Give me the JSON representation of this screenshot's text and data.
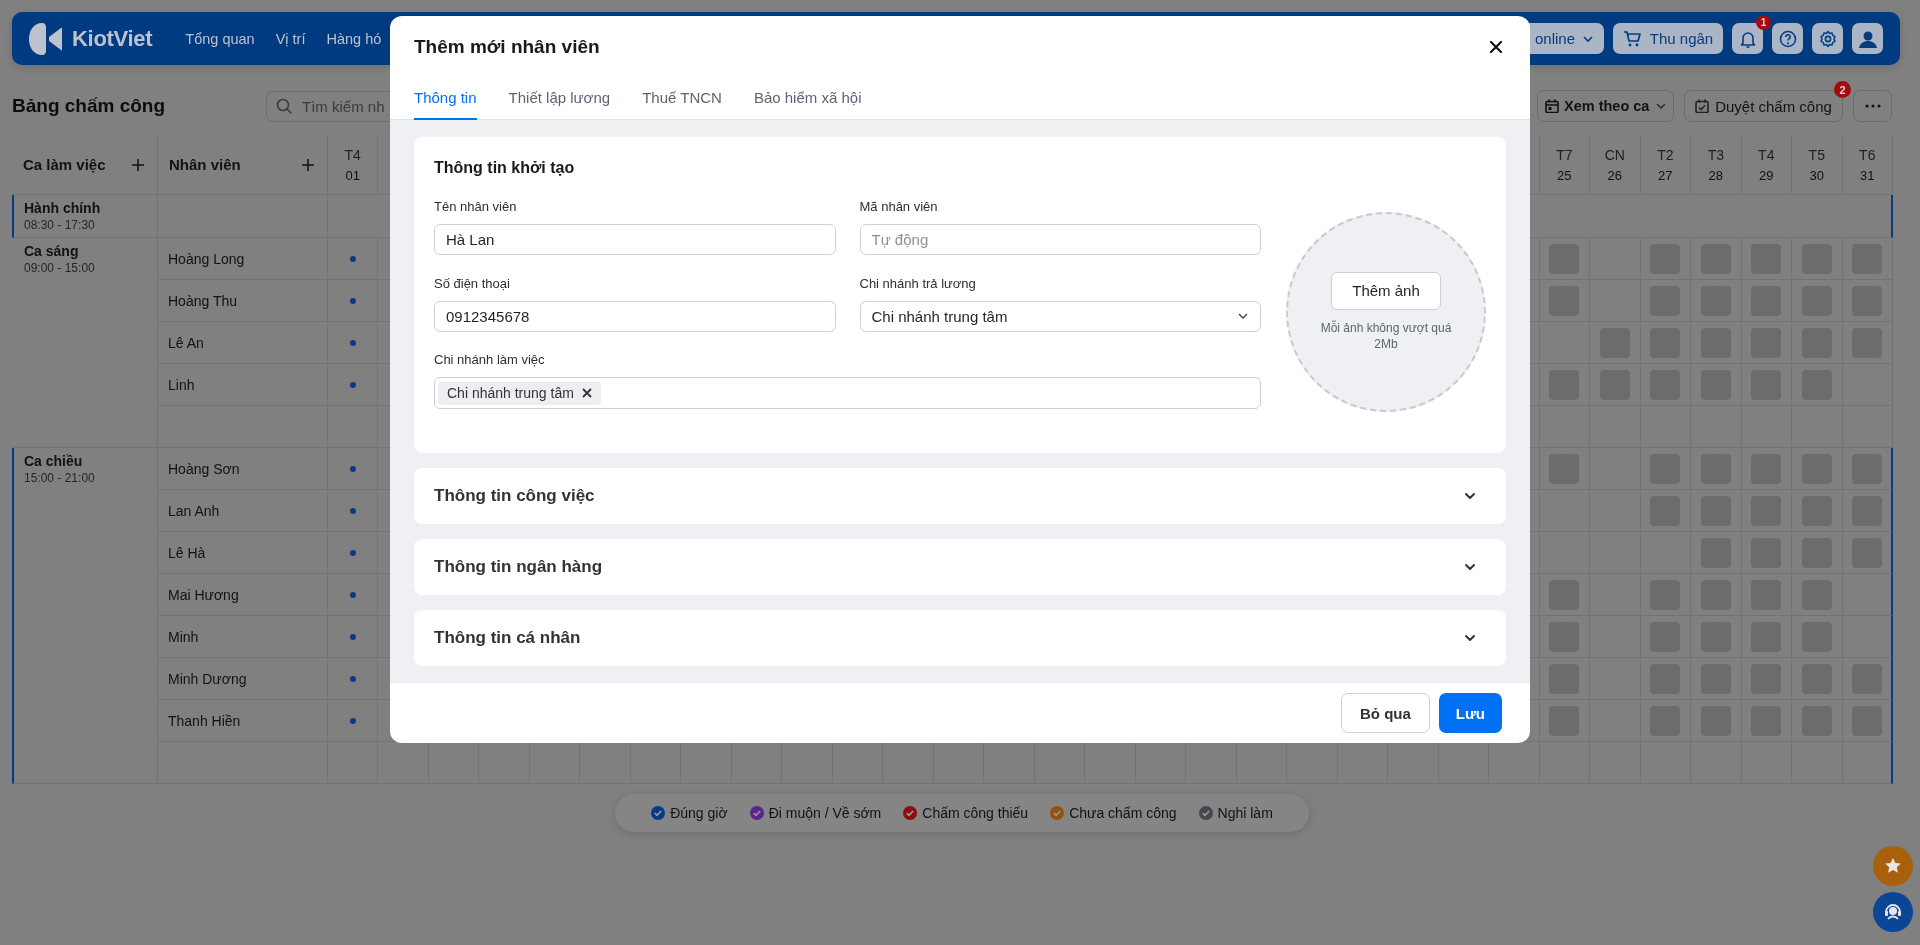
{
  "header": {
    "brand": "KiotViet",
    "nav": [
      {
        "label": "Tổng quan"
      },
      {
        "label": "Vị trí"
      },
      {
        "label": "Hàng hó"
      }
    ],
    "online_button": "online",
    "cashier_button": "Thu ngân",
    "notification_count": "1"
  },
  "toolbar": {
    "title": "Bảng chấm công",
    "search": {
      "placeholder": "Tìm kiếm nh"
    },
    "view_select": "Xem theo ca",
    "approve_button": "Duyệt chấm công",
    "approve_count": "2"
  },
  "table": {
    "columns": {
      "shift": "Ca làm việc",
      "employee": "Nhân viên"
    },
    "days_left": [
      {
        "weekday": "T4",
        "date": "01",
        "kind": "dot"
      }
    ],
    "days_right": [
      {
        "weekday": "T7",
        "date": "25",
        "kind": "block"
      },
      {
        "weekday": "CN",
        "date": "26",
        "kind": "block"
      },
      {
        "weekday": "T2",
        "date": "27",
        "kind": "block"
      },
      {
        "weekday": "T3",
        "date": "28",
        "kind": "block"
      },
      {
        "weekday": "T4",
        "date": "29",
        "kind": "block"
      },
      {
        "weekday": "T5",
        "date": "30",
        "kind": "block"
      },
      {
        "weekday": "T6",
        "date": "31",
        "kind": "block"
      }
    ],
    "shifts": [
      {
        "name": "Hành chính",
        "time": "08:30 - 17:30",
        "highlighted": true
      },
      {
        "name": "Ca sáng",
        "time": "09:00 - 15:00",
        "highlighted": false,
        "employees": [
          {
            "name": "Hoàng Long",
            "days": [
              true,
              true,
              false,
              true,
              true,
              true,
              true,
              true
            ]
          },
          {
            "name": "Hoàng Thu",
            "days": [
              true,
              true,
              false,
              true,
              true,
              true,
              true,
              true
            ]
          },
          {
            "name": "Lê An",
            "days": [
              true,
              false,
              true,
              true,
              true,
              true,
              true,
              true
            ]
          },
          {
            "name": "Linh",
            "days": [
              true,
              true,
              true,
              true,
              true,
              true,
              true,
              false
            ]
          }
        ]
      },
      {
        "name": "Ca chiều",
        "time": "15:00 - 21:00",
        "highlighted": true,
        "employees": [
          {
            "name": "Hoàng Sơn",
            "days": [
              true,
              true,
              false,
              true,
              true,
              true,
              true,
              true
            ]
          },
          {
            "name": "Lan Anh",
            "days": [
              true,
              false,
              false,
              true,
              true,
              true,
              true,
              true
            ]
          },
          {
            "name": "Lê Hà",
            "days": [
              true,
              false,
              false,
              false,
              true,
              true,
              true,
              true
            ]
          },
          {
            "name": "Mai Hương",
            "days": [
              true,
              true,
              false,
              true,
              true,
              true,
              true,
              false
            ]
          },
          {
            "name": "Minh",
            "days": [
              true,
              true,
              false,
              true,
              true,
              true,
              true,
              false
            ]
          },
          {
            "name": "Minh Dương",
            "days": [
              true,
              true,
              false,
              true,
              true,
              true,
              true,
              true
            ]
          },
          {
            "name": "Thanh Hiền",
            "days": [
              true,
              true,
              false,
              true,
              true,
              true,
              true,
              true
            ]
          }
        ]
      }
    ]
  },
  "legend": [
    {
      "label": "Đúng giờ",
      "color": "#08398a"
    },
    {
      "label": "Đi muộn / Về sớm",
      "color": "#5a2590"
    },
    {
      "label": "Chấm công thiếu",
      "color": "#8c0d12"
    },
    {
      "label": "Chưa chấm công",
      "color": "#94520c"
    },
    {
      "label": "Nghỉ làm",
      "color": "#45484d"
    }
  ],
  "dialog": {
    "title": "Thêm mới nhân viên",
    "tabs": [
      {
        "label": "Thông tin",
        "selected": true
      },
      {
        "label": "Thiết lập lương",
        "selected": false
      },
      {
        "label": "Thuế TNCN",
        "selected": false
      },
      {
        "label": "Bảo hiểm xã hội",
        "selected": false
      }
    ],
    "sections": [
      {
        "title": "Thông tin khởi tạo",
        "expanded": true,
        "fields": [
          {
            "kind": "text",
            "label": "Tên nhân viên",
            "value": "Hà Lan"
          },
          {
            "kind": "text",
            "label": "Mã nhân viên",
            "placeholder": "Tự động"
          },
          {
            "kind": "text",
            "label": "Số điện thoại",
            "value": "0912345678"
          },
          {
            "kind": "select",
            "label": "Chi nhánh trả lương",
            "value": "Chi nhánh trung tâm"
          },
          {
            "kind": "tags",
            "label": "Chi nhánh làm việc",
            "tags": [
              "Chi nhánh trung tâm"
            ]
          }
        ],
        "photo": {
          "button": "Thêm ảnh",
          "note": "Mỗi ảnh không vượt quá 2Mb"
        }
      },
      {
        "title": "Thông tin công việc",
        "expanded": false
      },
      {
        "title": "Thông tin ngân hàng",
        "expanded": false
      },
      {
        "title": "Thông tin cá nhân",
        "expanded": false
      }
    ],
    "buttons": [
      {
        "label": "Bỏ qua",
        "kind": "secondary"
      },
      {
        "label": "Lưu",
        "kind": "primary"
      }
    ]
  }
}
